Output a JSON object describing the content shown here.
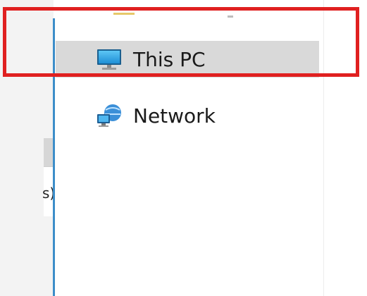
{
  "left_pane": {
    "partial_text": "s)"
  },
  "nav": {
    "items": [
      {
        "label": "This PC",
        "icon": "monitor-icon",
        "selected": true
      },
      {
        "label": "Network",
        "icon": "network-icon",
        "selected": false
      }
    ]
  },
  "colors": {
    "selected_bg": "#d9d9d9",
    "highlight_border": "#e02020",
    "splitter": "#3c8dc9"
  }
}
